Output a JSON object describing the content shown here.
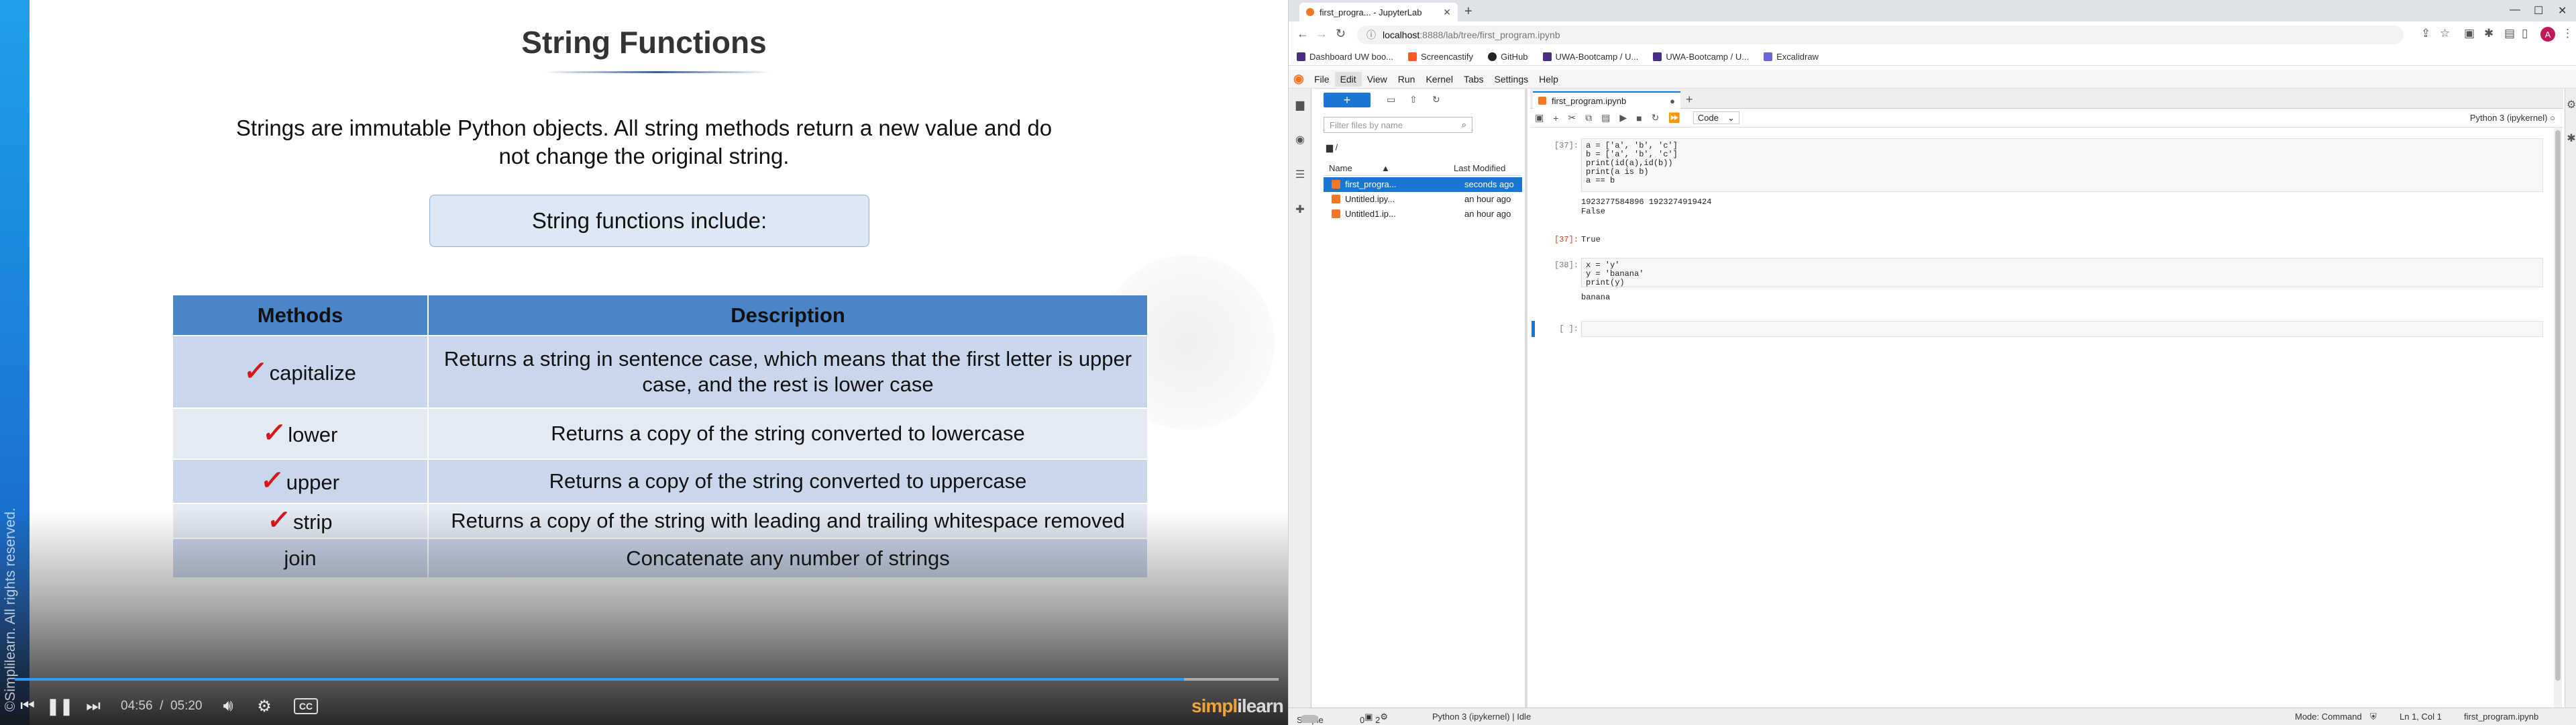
{
  "video": {
    "slide_title": "String Functions",
    "intro": "Strings are immutable Python objects. All string methods return a new value and do not change the original string.",
    "include_box": "String functions include:",
    "table": {
      "headers": [
        "Methods",
        "Description"
      ],
      "rows": [
        {
          "method": "capitalize",
          "description": "Returns a string in sentence case, which means that the first letter is upper case, and the rest is lower case",
          "checked": true
        },
        {
          "method": "lower",
          "description": "Returns a copy of the string converted to lowercase",
          "checked": true
        },
        {
          "method": "upper",
          "description": "Returns a copy of the string converted to uppercase",
          "checked": true
        },
        {
          "method": "strip",
          "description": "Returns a copy of the string with leading and trailing whitespace removed",
          "checked": true
        },
        {
          "method": "join",
          "description": "Concatenate any number of strings",
          "checked": false
        }
      ]
    },
    "copyright": "©Simplilearn. All rights reserved.",
    "player": {
      "current_time": "04:56",
      "separator": "/",
      "duration": "05:20",
      "progress": 0.925,
      "cc_label": "CC",
      "brand_left": "simpl",
      "brand_right": "ilearn"
    }
  },
  "browser": {
    "tab_title": "first_progra... - JupyterLab",
    "url_host": "localhost",
    "url_path": ":8888/lab/tree/first_program.ipynb",
    "avatar_letter": "A",
    "bookmarks": [
      {
        "label": "Dashboard UW boo...",
        "color": "#4b2e83"
      },
      {
        "label": "Screencastify",
        "color": "#ff5722"
      },
      {
        "label": "GitHub",
        "color": "#222222"
      },
      {
        "label": "UWA-Bootcamp / U...",
        "color": "#4b2e83"
      },
      {
        "label": "UWA-Bootcamp / U...",
        "color": "#4b2e83"
      },
      {
        "label": "Excalidraw",
        "color": "#6965db"
      }
    ]
  },
  "jupyter": {
    "menu": [
      "File",
      "Edit",
      "View",
      "Run",
      "Kernel",
      "Tabs",
      "Settings",
      "Help"
    ],
    "filter_placeholder": "Filter files by name",
    "path": "/",
    "file_headers": {
      "name": "Name",
      "modified": "Last Modified"
    },
    "files": [
      {
        "name": "first_progra...",
        "modified": "seconds ago",
        "selected": true
      },
      {
        "name": "Untitled.ipy...",
        "modified": "an hour ago",
        "selected": false
      },
      {
        "name": "Untitled1.ip...",
        "modified": "an hour ago",
        "selected": false
      }
    ],
    "notebook_tab": "first_program.ipynb",
    "cell_type": "Code",
    "kernel": "Python 3 (ipykernel)",
    "cells": [
      {
        "prompt": "[37]:",
        "code": "a = ['a', 'b', 'c']\nb = ['a', 'b', 'c']\nprint(id(a),id(b))\nprint(a is b)\na == b",
        "stdout": "1923277584896 1923274919424\nFalse",
        "out_prompt": "[37]:",
        "result": "True"
      },
      {
        "prompt": "[38]:",
        "code": "x = 'y'\ny = 'banana'\nprint(y)",
        "stdout": "banana",
        "out_prompt": "",
        "result": ""
      },
      {
        "prompt": "[ ]:",
        "code": "",
        "stdout": "",
        "out_prompt": "",
        "result": ""
      }
    ],
    "status": {
      "mode_label": "Simple",
      "count_a": "0",
      "count_b": "2",
      "kernel_status": "Python 3 (ipykernel) | Idle",
      "mode": "Mode: Command",
      "position": "Ln 1, Col 1",
      "file": "first_program.ipynb"
    }
  }
}
